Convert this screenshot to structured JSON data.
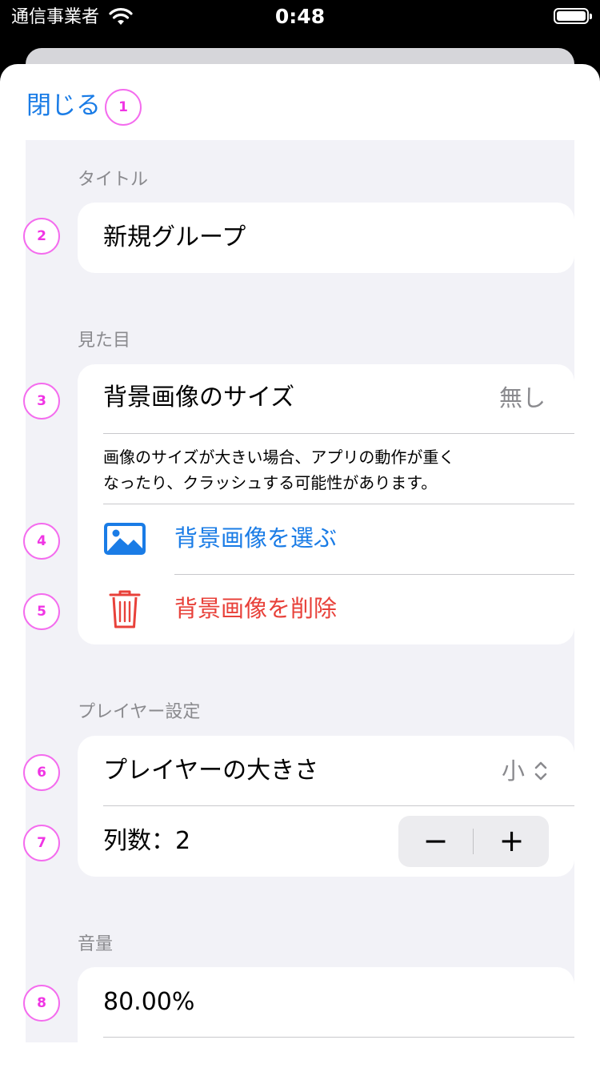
{
  "status_bar": {
    "carrier": "通信事業者",
    "time": "0:48"
  },
  "header": {
    "close_label": "閉じる"
  },
  "title_section": {
    "header": "タイトル",
    "value": "新規グループ"
  },
  "appearance_section": {
    "header": "見た目",
    "bg_size_label": "背景画像のサイズ",
    "bg_size_value": "無し",
    "note_line1": "画像のサイズが大きい場合、アプリの動作が重く",
    "note_line2": "なったり、クラッシュする可能性があります。",
    "choose_label": "背景画像を選ぶ",
    "delete_label": "背景画像を削除"
  },
  "player_section": {
    "header": "プレイヤー設定",
    "size_label": "プレイヤーの大きさ",
    "size_value": "小",
    "columns_label": "列数：2",
    "minus": "−",
    "plus": "+"
  },
  "volume_section": {
    "header": "音量",
    "value": "80.00%"
  },
  "markers": [
    "1",
    "2",
    "3",
    "4",
    "5",
    "6",
    "7",
    "8"
  ],
  "colors": {
    "accent": "#1a7ce6",
    "destructive": "#e8413a",
    "marker": "#f034e4",
    "grouped_bg": "#f2f2f7",
    "secondary_text": "#8a8a8e"
  },
  "icons": {
    "choose": "photo-icon",
    "delete": "trash-icon",
    "size_picker": "chevron-up-down-icon"
  }
}
